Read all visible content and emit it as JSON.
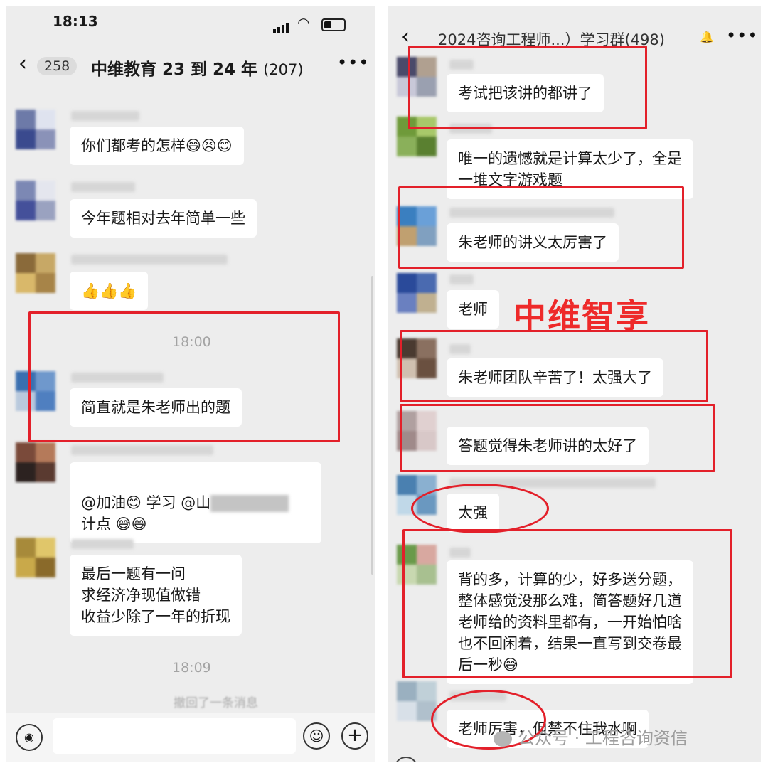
{
  "left": {
    "status_time": "18:13",
    "back_count": "258",
    "title": "中维教育 23 到 24 年",
    "member_count": "(207)",
    "timestamps": [
      "18:00",
      "18:09"
    ],
    "recall_text": "撤回了一条消息",
    "messages": [
      {
        "text": "你们都考的怎样😄😣😊"
      },
      {
        "text": "今年题相对去年简单一些"
      },
      {
        "text": "👍👍👍"
      },
      {
        "text": "简直就是朱老师出的题"
      },
      {
        "line1": "@加油😊 学习 @山",
        "line2": "计点 😅😄"
      },
      {
        "text": "最后一题有一问\n求经济净现值做错\n收益少除了一年的折现"
      }
    ]
  },
  "right": {
    "title": "2024咨询工程师...）学习群(498)",
    "watermark": "中维智享",
    "messages": [
      {
        "text": "考试把该讲的都讲了"
      },
      {
        "text": "唯一的遗憾就是计算太少了，全是\n一堆文字游戏题"
      },
      {
        "text": "朱老师的讲义太厉害了"
      },
      {
        "text": "老师"
      },
      {
        "text": "朱老师团队辛苦了！太强大了"
      },
      {
        "text": "答题觉得朱老师讲的太好了"
      },
      {
        "text": "太强"
      },
      {
        "text": "背的多，计算的少，好多送分题，\n整体感觉没那么难，简答题好几道\n老师给的资料里都有，一开始怕啥\n也不回闲着，结果一直写到交卷最\n后一秒😅"
      },
      {
        "text": "老师厉害，但禁不住我水啊"
      }
    ]
  },
  "credit": "公众号 · 工程咨询资信",
  "icons": {
    "back": "chevron-left-icon",
    "more": "more-dots-icon",
    "voice": "voice-icon",
    "emoji": "emoji-icon",
    "plus": "plus-icon",
    "signal": "signal-icon",
    "wifi": "wifi-icon",
    "battery": "battery-icon",
    "mute": "bell-mute-icon"
  },
  "colors": {
    "chat_bg": "#ededed",
    "bubble": "#ffffff",
    "highlight_red": "#e3202a"
  }
}
